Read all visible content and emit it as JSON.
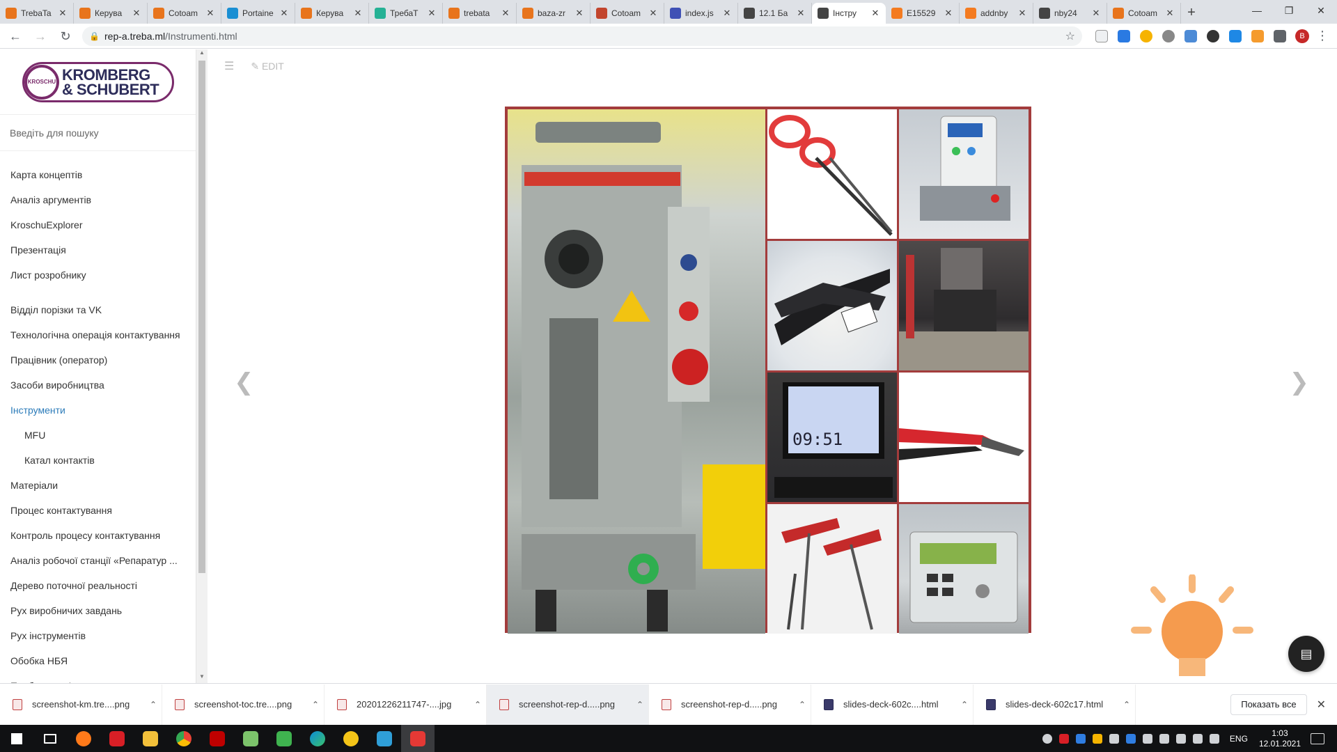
{
  "browser": {
    "tabs": [
      {
        "title": "TrebaTa",
        "color": "#e8741c"
      },
      {
        "title": "Керува",
        "color": "#e8741c"
      },
      {
        "title": "Cotoam",
        "color": "#e8741c"
      },
      {
        "title": "Portaine",
        "color": "#1a8fd3"
      },
      {
        "title": "Керува",
        "color": "#e8741c"
      },
      {
        "title": "ТребаТ",
        "color": "#25b195"
      },
      {
        "title": "trebata",
        "color": "#e8741c"
      },
      {
        "title": "baza-zr",
        "color": "#e8741c"
      },
      {
        "title": "Cotoam",
        "color": "#c2452d"
      },
      {
        "title": "index.js",
        "color": "#3f51b5"
      },
      {
        "title": "12.1 Ба",
        "color": "#444444"
      },
      {
        "title": "Інстру",
        "color": "#444444",
        "active": true
      },
      {
        "title": "E15529",
        "color": "#f47b20"
      },
      {
        "title": "addnby",
        "color": "#f47b20"
      },
      {
        "title": "nby24",
        "color": "#444444"
      },
      {
        "title": "Cotoam",
        "color": "#e8741c"
      }
    ],
    "new_tab": "+",
    "url_host": "rep-a.treba.ml",
    "url_path": "/Instrumenti.html"
  },
  "sidebar": {
    "logo_badge": "KROSCHU",
    "logo_line1": "KROMBERG",
    "logo_line2": "& SCHUBERT",
    "search_placeholder": "Введіть для пошуку",
    "group1": [
      "Карта концептів",
      "Аналіз аргументів",
      "KroschuExplorer",
      "Презентація",
      "Лист розробнику"
    ],
    "group2": [
      "Відділ порізки та VK",
      "Технологічна операція контактування",
      "Працівник (оператор)",
      "Засоби виробництва",
      "Інструменти",
      "MFU",
      "Катал контактів",
      "Матеріали",
      "Процес контактування",
      "Контроль процесу контактування",
      "Аналіз робочої станції «Репаратур ...",
      "Дерево поточної реальності",
      "Рух виробничих завдань",
      "Рух інструментів",
      "Обобка НБЯ",
      "Проблема зв'язку"
    ]
  },
  "toolbar": {
    "edit_label": "EDIT"
  },
  "gallery": {
    "border_color": "#a33c3c",
    "tiles": [
      "machine",
      "scissors",
      "crimp-tool",
      "wire-stripper",
      "press",
      "monitor",
      "side-cutter",
      "t-handle-keys",
      "control-unit"
    ]
  },
  "downloads": {
    "items": [
      "screenshot-km.tre....png",
      "screenshot-toc.tre....png",
      "20201226211747-....jpg",
      "screenshot-rep-d.....png",
      "screenshot-rep-d.....png",
      "slides-deck-602c....html",
      "slides-deck-602c17.html"
    ],
    "show_all": "Показать все"
  },
  "taskbar": {
    "lang": "ENG",
    "time": "1:03",
    "date": "12.01.2021"
  }
}
